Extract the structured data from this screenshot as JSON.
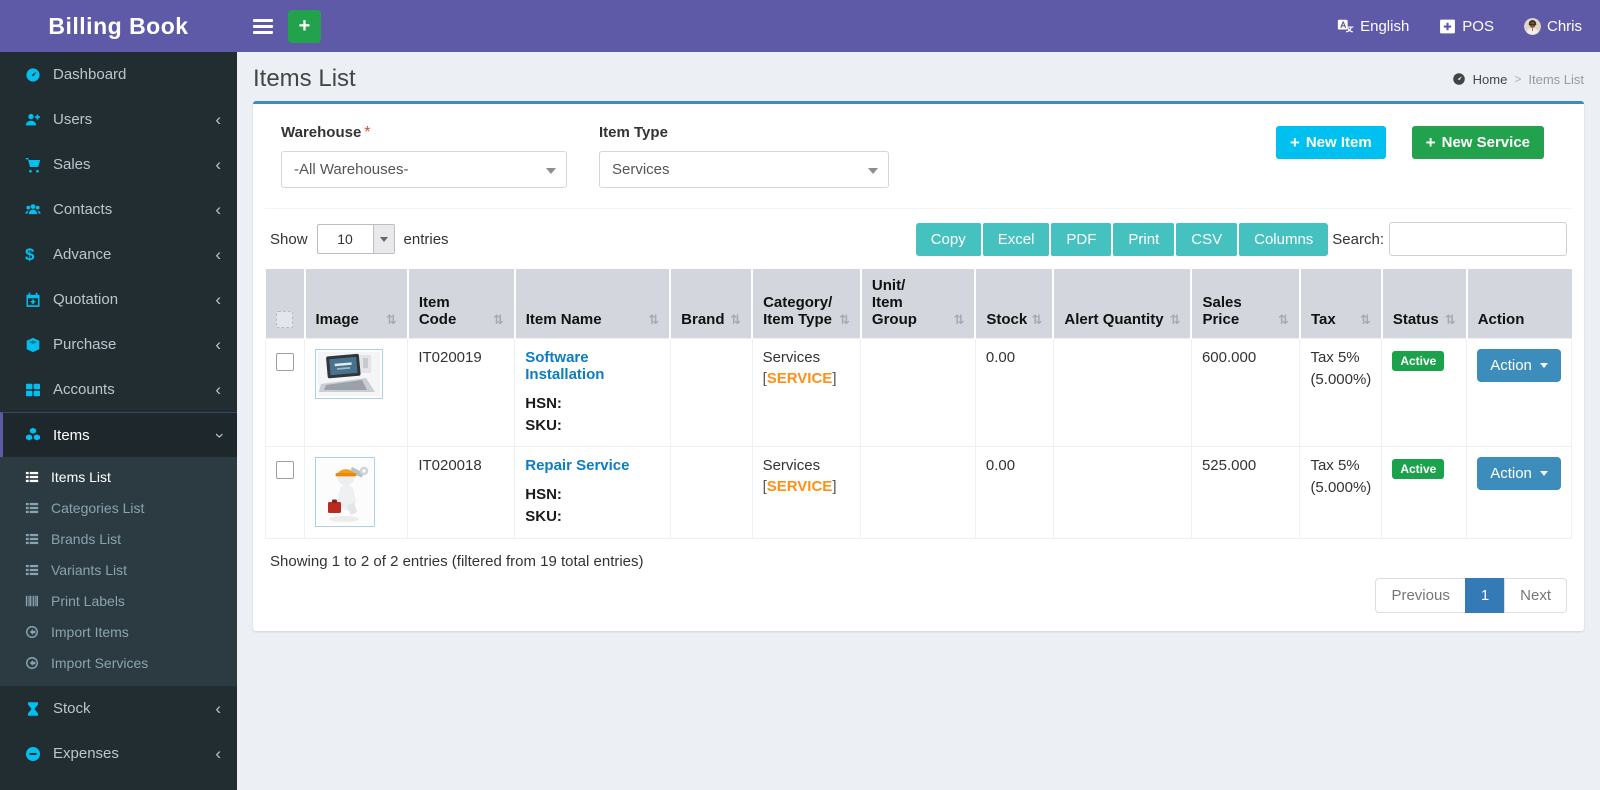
{
  "app": {
    "brand": "Billing Book"
  },
  "header": {
    "language_label": "English",
    "pos_label": "POS",
    "user_name": "Chris"
  },
  "sidebar": {
    "items": [
      {
        "label": "Dashboard",
        "icon": "dashboard-icon"
      },
      {
        "label": "Users",
        "icon": "user-plus-icon",
        "chevron": "left"
      },
      {
        "label": "Sales",
        "icon": "cart-icon",
        "chevron": "left"
      },
      {
        "label": "Contacts",
        "icon": "users-icon",
        "chevron": "left"
      },
      {
        "label": "Advance",
        "icon": "dollar-icon",
        "chevron": "left"
      },
      {
        "label": "Quotation",
        "icon": "calendar-plus-icon",
        "chevron": "left"
      },
      {
        "label": "Purchase",
        "icon": "cube-icon",
        "chevron": "left"
      },
      {
        "label": "Accounts",
        "icon": "grid-icon",
        "chevron": "left"
      },
      {
        "label": "Items",
        "icon": "cubes-icon",
        "chevron": "down",
        "active": true,
        "submenu": [
          {
            "label": "Items List",
            "icon": "list-icon",
            "active": true
          },
          {
            "label": "Categories List",
            "icon": "list-icon"
          },
          {
            "label": "Brands List",
            "icon": "list-icon"
          },
          {
            "label": "Variants List",
            "icon": "list-icon"
          },
          {
            "label": "Print Labels",
            "icon": "barcode-icon"
          },
          {
            "label": "Import Items",
            "icon": "import-icon"
          },
          {
            "label": "Import Services",
            "icon": "import-icon"
          }
        ]
      },
      {
        "label": "Stock",
        "icon": "hourglass-icon",
        "chevron": "left"
      },
      {
        "label": "Expenses",
        "icon": "minus-circle-icon",
        "chevron": "left"
      }
    ]
  },
  "page": {
    "title": "Items List",
    "breadcrumb": {
      "home": "Home",
      "current": "Items List"
    }
  },
  "filters": {
    "warehouse": {
      "label": "Warehouse",
      "required_mark": "*",
      "value": "-All Warehouses-"
    },
    "item_type": {
      "label": "Item Type",
      "value": "Services"
    },
    "new_item_button": "New Item",
    "new_service_button": "New Service"
  },
  "datatable": {
    "show_label": "Show",
    "page_length": "10",
    "entries_label": "entries",
    "export_buttons": [
      "Copy",
      "Excel",
      "PDF",
      "Print",
      "CSV",
      "Columns"
    ],
    "search_label": "Search:",
    "search_value": "",
    "columns": [
      {
        "label": "Image"
      },
      {
        "label": "Item Code"
      },
      {
        "label": "Item Name"
      },
      {
        "label": "Brand"
      },
      {
        "label": "Category/",
        "label2": "Item Type"
      },
      {
        "label": "Unit/",
        "label2": "Item Group"
      },
      {
        "label": "Stock"
      },
      {
        "label": "Alert Quantity"
      },
      {
        "label": "Sales Price"
      },
      {
        "label": "Tax"
      },
      {
        "label": "Status"
      },
      {
        "label": "Action"
      }
    ],
    "rows": [
      {
        "image": "laptop-photo",
        "item_code": "IT020019",
        "item_name": "Software Installation",
        "hsn_label": "HSN:",
        "sku_label": "SKU:",
        "brand": "",
        "category": "Services",
        "category_tag": "SERVICE",
        "unit_group": "",
        "stock": "0.00",
        "alert_quantity": "",
        "sales_price": "600.000",
        "tax": "Tax 5%",
        "tax_detail": "(5.000%)",
        "status": "Active",
        "action_label": "Action"
      },
      {
        "image": "repair-mascot",
        "item_code": "IT020018",
        "item_name": "Repair Service",
        "hsn_label": "HSN:",
        "sku_label": "SKU:",
        "brand": "",
        "category": "Services",
        "category_tag": "SERVICE",
        "unit_group": "",
        "stock": "0.00",
        "alert_quantity": "",
        "sales_price": "525.000",
        "tax": "Tax 5%",
        "tax_detail": "(5.000%)",
        "status": "Active",
        "action_label": "Action"
      }
    ],
    "info": "Showing 1 to 2 of 2 entries (filtered from 19 total entries)",
    "pagination": {
      "previous": "Previous",
      "page": "1",
      "next": "Next"
    }
  },
  "colors": {
    "header_purple": "#5f5aa8",
    "sidebar_dark": "#222d32",
    "icon_cyan": "#00c0ef",
    "new_item_cyan": "#00c0ef",
    "new_service_green": "#23a24d",
    "export_teal": "#45c2c0",
    "action_blue": "#3c8dbc",
    "link_blue": "#0b7dc1",
    "tag_orange": "#ff9017",
    "status_green": "#1ca24c",
    "active_page_blue": "#337ab7"
  }
}
